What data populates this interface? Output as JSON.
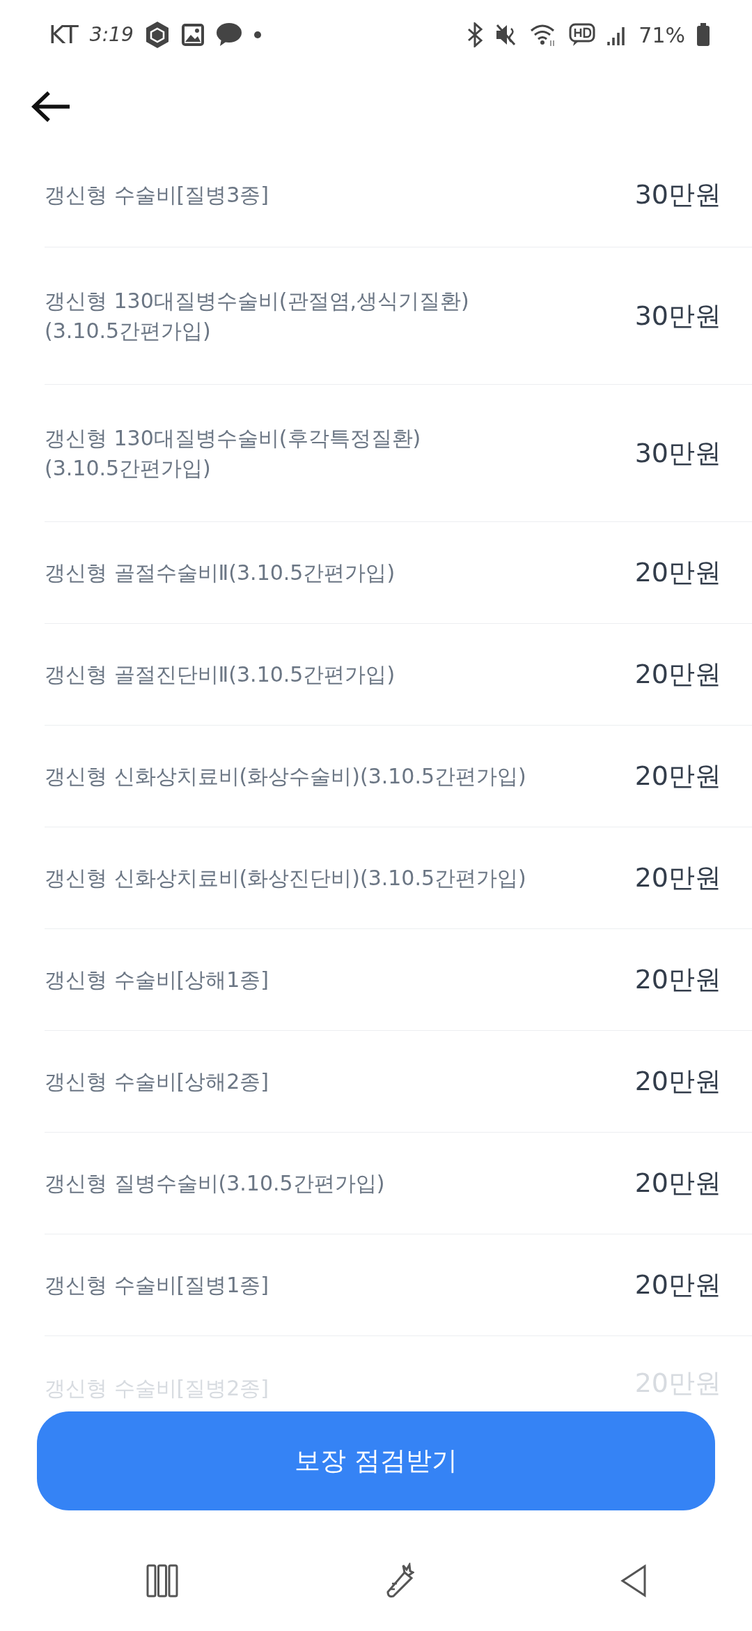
{
  "status_bar": {
    "carrier": "KT",
    "time": "3:19",
    "battery": "71%"
  },
  "items": [
    {
      "label": "갱신형 수술비[질병3종]",
      "amount": "30만원",
      "faded": false
    },
    {
      "label": "갱신형 130대질병수술비(관절염,생식기질환)\n(3.10.5간편가입)",
      "amount": "30만원",
      "faded": false
    },
    {
      "label": "갱신형 130대질병수술비(후각특정질환)\n(3.10.5간편가입)",
      "amount": "30만원",
      "faded": false
    },
    {
      "label": "갱신형 골절수술비Ⅱ(3.10.5간편가입)",
      "amount": "20만원",
      "faded": false
    },
    {
      "label": "갱신형 골절진단비Ⅱ(3.10.5간편가입)",
      "amount": "20만원",
      "faded": false
    },
    {
      "label": "갱신형 신화상치료비(화상수술비)(3.10.5간편가입)",
      "amount": "20만원",
      "faded": false
    },
    {
      "label": "갱신형 신화상치료비(화상진단비)(3.10.5간편가입)",
      "amount": "20만원",
      "faded": false
    },
    {
      "label": "갱신형 수술비[상해1종]",
      "amount": "20만원",
      "faded": false
    },
    {
      "label": "갱신형 수술비[상해2종]",
      "amount": "20만원",
      "faded": false
    },
    {
      "label": "갱신형 질병수술비(3.10.5간편가입)",
      "amount": "20만원",
      "faded": false
    },
    {
      "label": "갱신형 수술비[질병1종]",
      "amount": "20만원",
      "faded": false
    },
    {
      "label": "갱신형 수술비[질병2종]",
      "amount": "20만원",
      "faded": true
    }
  ],
  "cta_button": "보장 점검받기"
}
